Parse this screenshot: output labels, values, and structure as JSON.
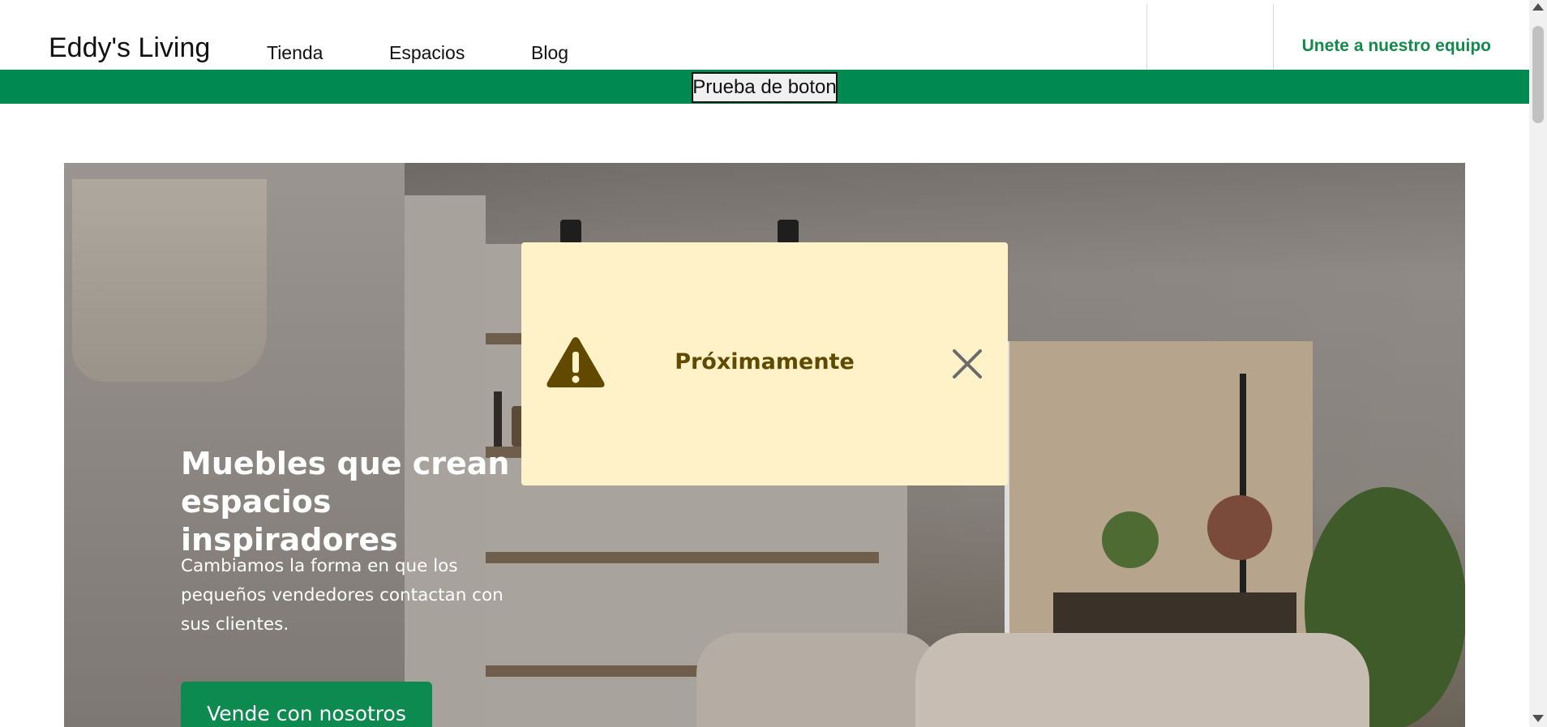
{
  "header": {
    "brand": "Eddy's Living",
    "nav": [
      {
        "label": "Tienda"
      },
      {
        "label": "Espacios"
      },
      {
        "label": "Blog"
      }
    ],
    "join_label": "Unete a nuestro equipo"
  },
  "banner": {
    "button_label": "Prueba de boton",
    "color": "#008a52"
  },
  "hero": {
    "title": "Muebles que crean espacios inspiradores",
    "subtitle": "Cambiamos la forma en que los pequeños vendedores contactan con sus clientes.",
    "cta_label": "Vende con nosotros"
  },
  "modal": {
    "message": "Próximamente",
    "icon": "warning-icon",
    "close_icon": "close-icon",
    "background": "#fff2c8",
    "text_color": "#604a00"
  },
  "colors": {
    "accent": "#138a4a",
    "cta": "#0d8a4f"
  }
}
